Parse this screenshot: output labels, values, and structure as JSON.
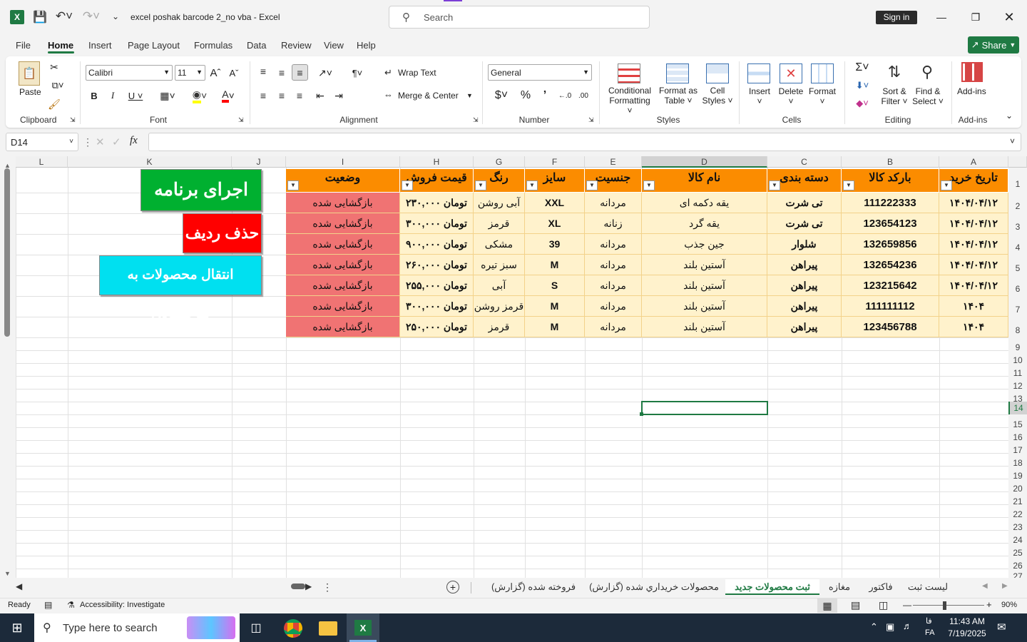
{
  "titlebar": {
    "filename": "excel poshak barcode 2_no vba",
    "app": "Excel",
    "separator": "-",
    "search_placeholder": "Search",
    "sign_in": "Sign in"
  },
  "tabs": [
    "File",
    "Home",
    "Insert",
    "Page Layout",
    "Formulas",
    "Data",
    "Review",
    "View",
    "Help"
  ],
  "share": "Share",
  "ribbon": {
    "paste": "Paste",
    "clipboard": "Clipboard",
    "font_name": "Calibri",
    "font_size": "11",
    "font": "Font",
    "wrap_text": "Wrap Text",
    "merge_center": "Merge & Center",
    "alignment": "Alignment",
    "number_format": "General",
    "number": "Number",
    "conditional": "Conditional",
    "formatting": "Formatting",
    "format_as": "Format as",
    "table": "Table",
    "cell": "Cell",
    "styles_btn": "Styles",
    "styles": "Styles",
    "insert": "Insert",
    "delete": "Delete",
    "format": "Format",
    "cells": "Cells",
    "sort": "Sort &",
    "filter": "Filter",
    "find": "Find &",
    "select": "Select",
    "editing": "Editing",
    "addins_btn": "Add-ins",
    "addins": "Add-ins"
  },
  "namebox": "D14",
  "fx": "fx",
  "columns": [
    "A",
    "B",
    "C",
    "D",
    "E",
    "F",
    "G",
    "H",
    "I",
    "J",
    "K",
    "L"
  ],
  "rows": [
    "1",
    "2",
    "3",
    "4",
    "5",
    "6",
    "7",
    "8",
    "9",
    "10",
    "11",
    "12",
    "13",
    "14",
    "15",
    "16",
    "17",
    "18",
    "19",
    "20",
    "21",
    "22",
    "23",
    "24",
    "25",
    "26",
    "27"
  ],
  "table": {
    "headers": [
      "تاریخ خرید",
      "بارکد کالا",
      "دسته بندی",
      "نام کالا",
      "جنسیت",
      "سایز",
      "رنگ",
      "قیمت فروش",
      "وضعیت"
    ],
    "rows": [
      [
        "۱۴۰۴/۰۴/۱۲",
        "111222333",
        "تی شرت",
        "یقه دکمه ای",
        "مردانه",
        "XXL",
        "آبی روشن",
        "۲۳۰,۰۰۰ تومان",
        "بازگشایی شده"
      ],
      [
        "۱۴۰۴/۰۴/۱۲",
        "123654123",
        "تی شرت",
        "یقه گرد",
        "زنانه",
        "XL",
        "قرمز",
        "۳۰۰,۰۰۰ تومان",
        "بازگشایی شده"
      ],
      [
        "۱۴۰۴/۰۴/۱۲",
        "132659856",
        "شلوار",
        "جین جذب",
        "مردانه",
        "39",
        "مشکی",
        "۹۰۰,۰۰۰ تومان",
        "بازگشایی شده"
      ],
      [
        "۱۴۰۴/۰۴/۱۲",
        "132654236",
        "پیراهن",
        "آستین بلند",
        "مردانه",
        "M",
        "سبز تیره",
        "۲۶۰,۰۰۰ تومان",
        "بازگشایی شده"
      ],
      [
        "۱۴۰۴/۰۴/۱۲",
        "123215642",
        "پیراهن",
        "آستین بلند",
        "مردانه",
        "S",
        "آبی",
        "۲۵۵,۰۰۰ تومان",
        "بازگشایی شده"
      ],
      [
        "۱۴۰۴",
        "111111112",
        "پیراهن",
        "آستین بلند",
        "مردانه",
        "M",
        "قرمز روشن",
        "۳۰۰,۰۰۰ تومان",
        "بازگشایی شده"
      ],
      [
        "۱۴۰۴",
        "123456788",
        "پیراهن",
        "آستین بلند",
        "مردانه",
        "M",
        "قرمز",
        "۲۵۰,۰۰۰ تومان",
        "بازگشایی شده"
      ]
    ]
  },
  "buttons": {
    "run": "اجرای برنامه",
    "delete_row": "حذف ردیف",
    "transfer": "انتقال محصولات به موجـــودی"
  },
  "sheets": [
    "لیست ثبت",
    "فاکتور",
    "مغازه",
    "ثبت محصولات جدید",
    "محصولات خریداري شده (گزارش)",
    "فروخته شده (گزارش)"
  ],
  "status": {
    "ready": "Ready",
    "accessibility": "Accessibility: Investigate",
    "zoom": "90%"
  },
  "taskbar": {
    "search": "Type here to search",
    "lang": "FA",
    "lang2": "فا",
    "time": "11:43 AM",
    "date": "7/19/2025"
  },
  "colors": {
    "header": "#fb8c00",
    "row": "#fff2cc",
    "status_cell": "#f07373",
    "run": "#00b030",
    "delete": "#ff0000",
    "transfer": "#00e0f0",
    "excel_green": "#1f7a43"
  }
}
